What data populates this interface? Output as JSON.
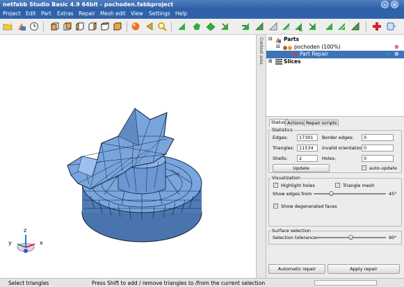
{
  "window": {
    "title": "netfabb Studio Basic 4.9 64bit - pochoden.fabbproject"
  },
  "menu": [
    "Project",
    "Edit",
    "Part",
    "Extras",
    "Repair",
    "Mesh edit",
    "View",
    "Settings",
    "Help"
  ],
  "toolbar": {
    "icons": [
      "open-file-icon",
      "add-part-icon",
      "clock-icon",
      "view-front-icon",
      "view-back-icon",
      "view-left-icon",
      "view-right-icon",
      "view-top-icon",
      "view-bottom-icon",
      "render-sphere-icon",
      "arrow-back-icon",
      "zoom-icon",
      "select-triangle-icon",
      "select-shell-icon",
      "select-surface-icon",
      "select-brush-icon",
      "select-plane-icon",
      "select-all-icon",
      "deselect-icon",
      "invert-selection-icon",
      "select-mode-icon",
      "move-icon",
      "hide-icon",
      "cut-icon",
      "add-triangle-icon",
      "settings-dropdown-icon"
    ]
  },
  "context_area": {
    "label": "Context area"
  },
  "tree": {
    "parts_label": "Parts",
    "part_name": "pochoden (100%)",
    "repair_label": "Part Repair",
    "slices_label": "Slices"
  },
  "tabs": [
    "Status",
    "Actions",
    "Repair scripts"
  ],
  "statistics": {
    "title": "Statistics",
    "edges_label": "Edges:",
    "edges": "17301",
    "triangles_label": "Triangles:",
    "triangles": "11534",
    "shells_label": "Shells:",
    "shells": "2",
    "border_edges_label": "Border edges:",
    "border_edges": "0",
    "invalid_orientation_label": "invalid orientation:",
    "invalid_orientation": "0",
    "holes_label": "Holes:",
    "holes": "0",
    "update_label": "Update",
    "auto_update_label": "auto-update"
  },
  "visualization": {
    "title": "Visualization",
    "highlight_holes_label": "Highlight holes",
    "triangle_mesh_label": "Triangle mesh",
    "show_edges_label": "Show edges from",
    "edge_angle": "45°",
    "edge_angle_fraction": 0.25,
    "show_degenerated_label": "Show degenerated faces"
  },
  "surface_selection": {
    "title": "Surface selection",
    "tolerance_label": "Selection tolerance:",
    "tolerance": "90°",
    "tolerance_fraction": 0.5
  },
  "buttons": {
    "automatic_repair": "Automatic repair",
    "apply_repair": "Apply repair"
  },
  "status": {
    "mode": "Select triangles",
    "hint": "Press Shift to add / remove triangles to /from the current selection"
  },
  "colors": {
    "title_bar": "#2d5da2",
    "mesh": "#6f9fd8",
    "selection": "#3f73b8"
  }
}
